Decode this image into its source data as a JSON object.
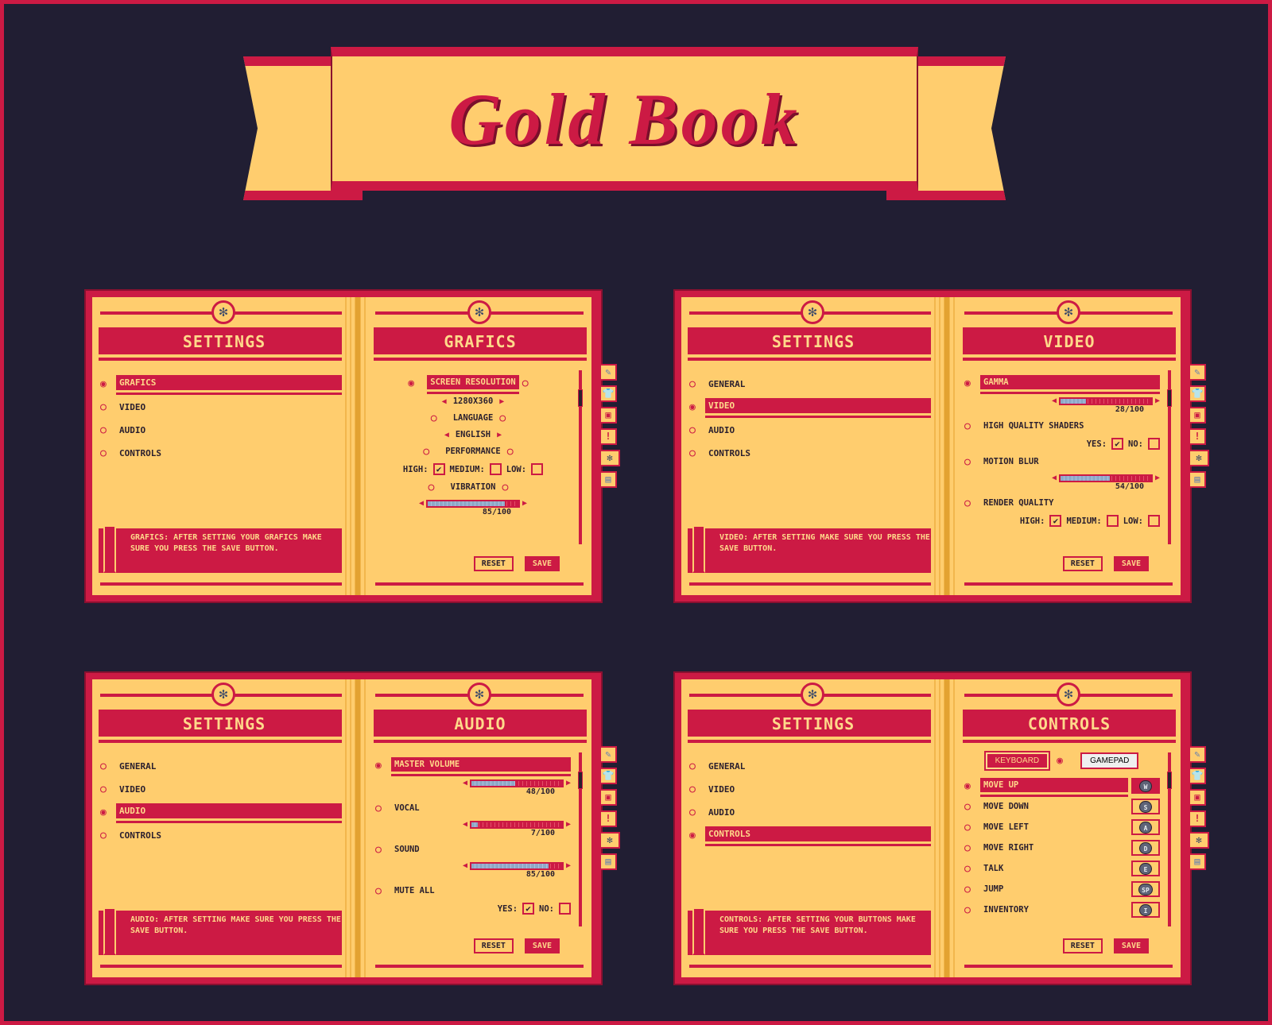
{
  "title": "Gold Book",
  "colors": {
    "background": "#211e33",
    "crimson": "#cc1a44",
    "gold": "#ffcd6e",
    "slider_fill": "#8fa8c8"
  },
  "side_tabs": [
    {
      "icon": "quill-icon",
      "glyph": "✎"
    },
    {
      "icon": "shirt-icon",
      "glyph": "👕"
    },
    {
      "icon": "bag-icon",
      "glyph": "▣"
    },
    {
      "icon": "quest-book-icon",
      "glyph": "!"
    },
    {
      "icon": "gear-icon",
      "glyph": "✻",
      "active": true
    },
    {
      "icon": "save-disk-icon",
      "glyph": "▤"
    }
  ],
  "books": [
    {
      "left_title": "SETTINGS",
      "right_title": "GRAFICS",
      "layout": "center",
      "menu": [
        {
          "label": "GRAFICS",
          "selected": true
        },
        {
          "label": "VIDEO"
        },
        {
          "label": "AUDIO"
        },
        {
          "label": "CONTROLS"
        }
      ],
      "info": "GRAFICS: AFTER SETTING YOUR GRAFICS MAKE SURE YOU PRESS THE SAVE BUTTON.",
      "items": [
        {
          "type": "header",
          "label": "SCREEN RESOLUTION",
          "selected": true
        },
        {
          "type": "selector",
          "value": "1280X360"
        },
        {
          "type": "header",
          "label": "LANGUAGE"
        },
        {
          "type": "selector",
          "value": "ENGLISH"
        },
        {
          "type": "header",
          "label": "PERFORMANCE"
        },
        {
          "type": "checks",
          "options": [
            {
              "label": "HIGH:",
              "checked": true
            },
            {
              "label": "MEDIUM:",
              "checked": false
            },
            {
              "label": "LOW:",
              "checked": false
            }
          ]
        },
        {
          "type": "header",
          "label": "VIBRATION"
        },
        {
          "type": "slider",
          "value": 85,
          "value_label": "85/100"
        }
      ],
      "reset": "RESET",
      "save": "SAVE"
    },
    {
      "left_title": "SETTINGS",
      "right_title": "VIDEO",
      "layout": "left",
      "menu": [
        {
          "label": "GENERAL"
        },
        {
          "label": "VIDEO",
          "selected": true
        },
        {
          "label": "AUDIO"
        },
        {
          "label": "CONTROLS"
        }
      ],
      "info": "VIDEO: AFTER SETTING MAKE SURE YOU PRESS THE SAVE BUTTON.",
      "items": [
        {
          "type": "row",
          "label": "GAMMA",
          "selected": true
        },
        {
          "type": "slider",
          "value": 28,
          "value_label": "28/100"
        },
        {
          "type": "row",
          "label": "HIGH QUALITY SHADERS"
        },
        {
          "type": "checks",
          "options": [
            {
              "label": "YES:",
              "checked": true
            },
            {
              "label": "NO:",
              "checked": false
            }
          ]
        },
        {
          "type": "row",
          "label": "MOTION BLUR"
        },
        {
          "type": "slider",
          "value": 54,
          "value_label": "54/100"
        },
        {
          "type": "row",
          "label": "RENDER QUALITY"
        },
        {
          "type": "checks",
          "options": [
            {
              "label": "HIGH:",
              "checked": true
            },
            {
              "label": "MEDIUM:",
              "checked": false
            },
            {
              "label": "LOW:",
              "checked": false
            }
          ]
        }
      ],
      "reset": "RESET",
      "save": "SAVE"
    },
    {
      "left_title": "SETTINGS",
      "right_title": "AUDIO",
      "layout": "left",
      "menu": [
        {
          "label": "GENERAL"
        },
        {
          "label": "VIDEO"
        },
        {
          "label": "AUDIO",
          "selected": true
        },
        {
          "label": "CONTROLS"
        }
      ],
      "info": "AUDIO: AFTER SETTING MAKE SURE YOU PRESS THE SAVE BUTTON.",
      "items": [
        {
          "type": "row",
          "label": "MASTER VOLUME",
          "selected": true
        },
        {
          "type": "slider",
          "value": 48,
          "value_label": "48/100"
        },
        {
          "type": "row",
          "label": "VOCAL"
        },
        {
          "type": "slider",
          "value": 7,
          "value_label": "7/100"
        },
        {
          "type": "row",
          "label": "SOUND"
        },
        {
          "type": "slider",
          "value": 85,
          "value_label": "85/100"
        },
        {
          "type": "row",
          "label": "MUTE ALL"
        },
        {
          "type": "checks",
          "options": [
            {
              "label": "YES:",
              "checked": true
            },
            {
              "label": "NO:",
              "checked": false
            }
          ]
        }
      ],
      "reset": "RESET",
      "save": "SAVE"
    },
    {
      "left_title": "SETTINGS",
      "right_title": "CONTROLS",
      "layout": "left",
      "menu": [
        {
          "label": "GENERAL"
        },
        {
          "label": "VIDEO"
        },
        {
          "label": "AUDIO"
        },
        {
          "label": "CONTROLS",
          "selected": true
        }
      ],
      "info": "CONTROLS: AFTER SETTING YOUR BUTTONS MAKE SURE YOU PRESS THE SAVE BUTTON.",
      "toggle": [
        {
          "label": "KEYBOARD",
          "active": true
        },
        {
          "label": "GAMEPAD"
        }
      ],
      "items": [
        {
          "type": "key",
          "label": "MOVE UP",
          "key": "W",
          "selected": true
        },
        {
          "type": "key",
          "label": "MOVE DOWN",
          "key": "S"
        },
        {
          "type": "key",
          "label": "MOVE LEFT",
          "key": "A"
        },
        {
          "type": "key",
          "label": "MOVE RIGHT",
          "key": "D"
        },
        {
          "type": "key",
          "label": "TALK",
          "key": "E"
        },
        {
          "type": "key",
          "label": "JUMP",
          "key": "SP"
        },
        {
          "type": "key",
          "label": "INVENTORY",
          "key": "I"
        }
      ],
      "reset": "RESET",
      "save": "SAVE"
    }
  ]
}
